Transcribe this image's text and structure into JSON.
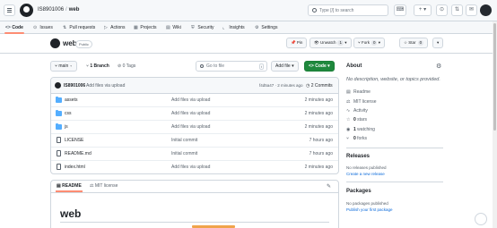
{
  "header": {
    "owner": "IS8901006",
    "separator": "/",
    "repo": "web",
    "search_placeholder": "Type [/] to search",
    "search_key": "/",
    "buttons": [
      "⌨",
      "+ ▾",
      "⊙",
      "⇅",
      "✉"
    ]
  },
  "nav": {
    "tabs": [
      {
        "icon": "<>",
        "label": "Code"
      },
      {
        "icon": "⊙",
        "label": "Issues"
      },
      {
        "icon": "⇅",
        "label": "Pull requests"
      },
      {
        "icon": "▷",
        "label": "Actions"
      },
      {
        "icon": "▦",
        "label": "Projects"
      },
      {
        "icon": "▤",
        "label": "Wiki"
      },
      {
        "icon": "⛨",
        "label": "Security"
      },
      {
        "icon": "⌞",
        "label": "Insights"
      },
      {
        "icon": "⚙",
        "label": "Settings"
      }
    ]
  },
  "repo_header": {
    "name": "web",
    "visibility": "Public",
    "pin": "Pin",
    "unwatch": "Unwatch",
    "unwatch_count": "1",
    "fork": "Fork",
    "fork_count": "0",
    "star": "Star",
    "star_count": "0"
  },
  "toolbar": {
    "branch": "main",
    "branches": "1 Branch",
    "tags": "0 Tags",
    "go_to_file": "Go to file",
    "go_to_file_key": "t",
    "add_file": "Add file",
    "code": "Code"
  },
  "commit": {
    "user": "IS8901006",
    "message": "Add files via upload",
    "meta": "f4d5a47 · 2 minutes ago",
    "count": "2 Commits"
  },
  "files": [
    {
      "type": "dir",
      "name": "assets",
      "message": "Add files via upload",
      "time": "2 minutes ago"
    },
    {
      "type": "dir",
      "name": "css",
      "message": "Add files via upload",
      "time": "2 minutes ago"
    },
    {
      "type": "dir",
      "name": "js",
      "message": "Add files via upload",
      "time": "2 minutes ago"
    },
    {
      "type": "file",
      "name": "LICENSE",
      "message": "Initial commit",
      "time": "7 hours ago"
    },
    {
      "type": "file",
      "name": "README.md",
      "message": "Initial commit",
      "time": "7 hours ago"
    },
    {
      "type": "file",
      "name": "index.html",
      "message": "Add files via upload",
      "time": "2 minutes ago"
    }
  ],
  "readme": {
    "tab_readme": "README",
    "tab_license": "MIT license",
    "heading": "web"
  },
  "about": {
    "title": "About",
    "description": "No description, website, or topics provided.",
    "readme": "Readme",
    "license": "MIT license",
    "activity": "Activity",
    "stars_count": "0",
    "stars_label": "stars",
    "watching_count": "1",
    "watching_label": "watching",
    "forks_count": "0",
    "forks_label": "forks"
  },
  "releases": {
    "title": "Releases",
    "note": "No releases published",
    "link": "Create a new release"
  },
  "packages": {
    "title": "Packages",
    "note": "No packages published",
    "link": "Publish your first package"
  }
}
